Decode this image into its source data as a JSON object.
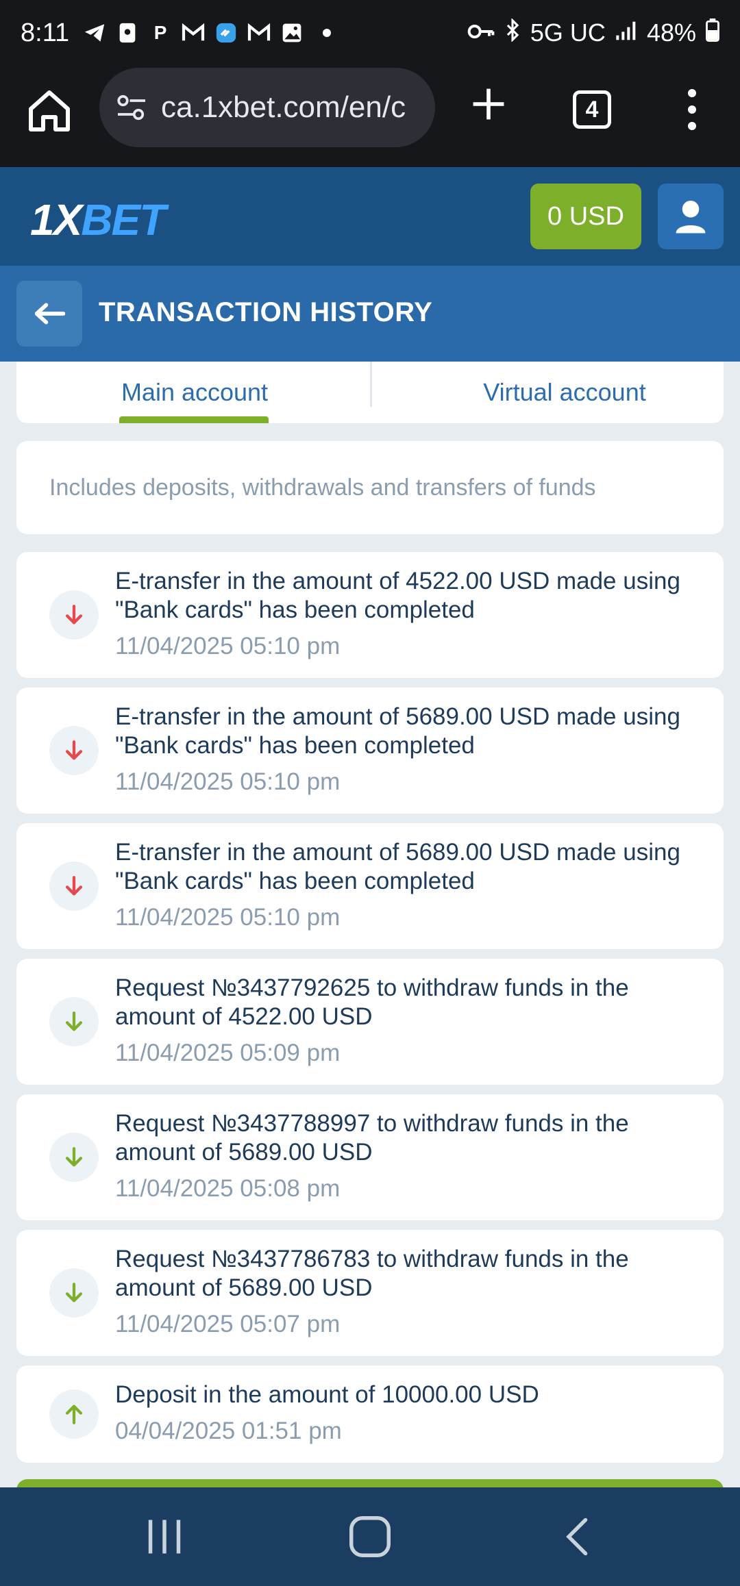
{
  "status_bar": {
    "time": "8:11",
    "network": "5G UC",
    "battery": "48%"
  },
  "browser": {
    "url": "ca.1xbet.com/en/c",
    "tab_count": "4"
  },
  "site": {
    "logo_part1": "1X",
    "logo_part2": "BET",
    "balance": "0 USD"
  },
  "page": {
    "title": "TRANSACTION HISTORY"
  },
  "tabs": {
    "main": "Main account",
    "virtual": "Virtual account"
  },
  "info": {
    "text": "Includes deposits, withdrawals and transfers of funds"
  },
  "transactions": [
    {
      "description": "E-transfer in the amount of 4522.00 USD made using \"Bank cards\" has been completed",
      "date": "11/04/2025 05:10 pm",
      "direction": "down",
      "color": "#e5484d"
    },
    {
      "description": "E-transfer in the amount of 5689.00 USD made using \"Bank cards\" has been completed",
      "date": "11/04/2025 05:10 pm",
      "direction": "down",
      "color": "#e5484d"
    },
    {
      "description": "E-transfer in the amount of 5689.00 USD made using \"Bank cards\" has been completed",
      "date": "11/04/2025 05:10 pm",
      "direction": "down",
      "color": "#e5484d"
    },
    {
      "description": "Request №3437792625 to withdraw funds in the amount of 4522.00 USD",
      "date": "11/04/2025 05:09 pm",
      "direction": "down",
      "color": "#7daf2a"
    },
    {
      "description": "Request №3437788997 to withdraw funds in the amount of 5689.00 USD",
      "date": "11/04/2025 05:08 pm",
      "direction": "down",
      "color": "#7daf2a"
    },
    {
      "description": "Request №3437786783 to withdraw funds in the amount of 5689.00 USD",
      "date": "11/04/2025 05:07 pm",
      "direction": "down",
      "color": "#7daf2a"
    },
    {
      "description": "Deposit in the amount of 10000.00 USD",
      "date": "04/04/2025 01:51 pm",
      "direction": "up",
      "color": "#7daf2a"
    }
  ],
  "colors": {
    "brand_blue": "#1b5083",
    "accent_green": "#7daf2a",
    "red_arrow": "#e5484d"
  }
}
